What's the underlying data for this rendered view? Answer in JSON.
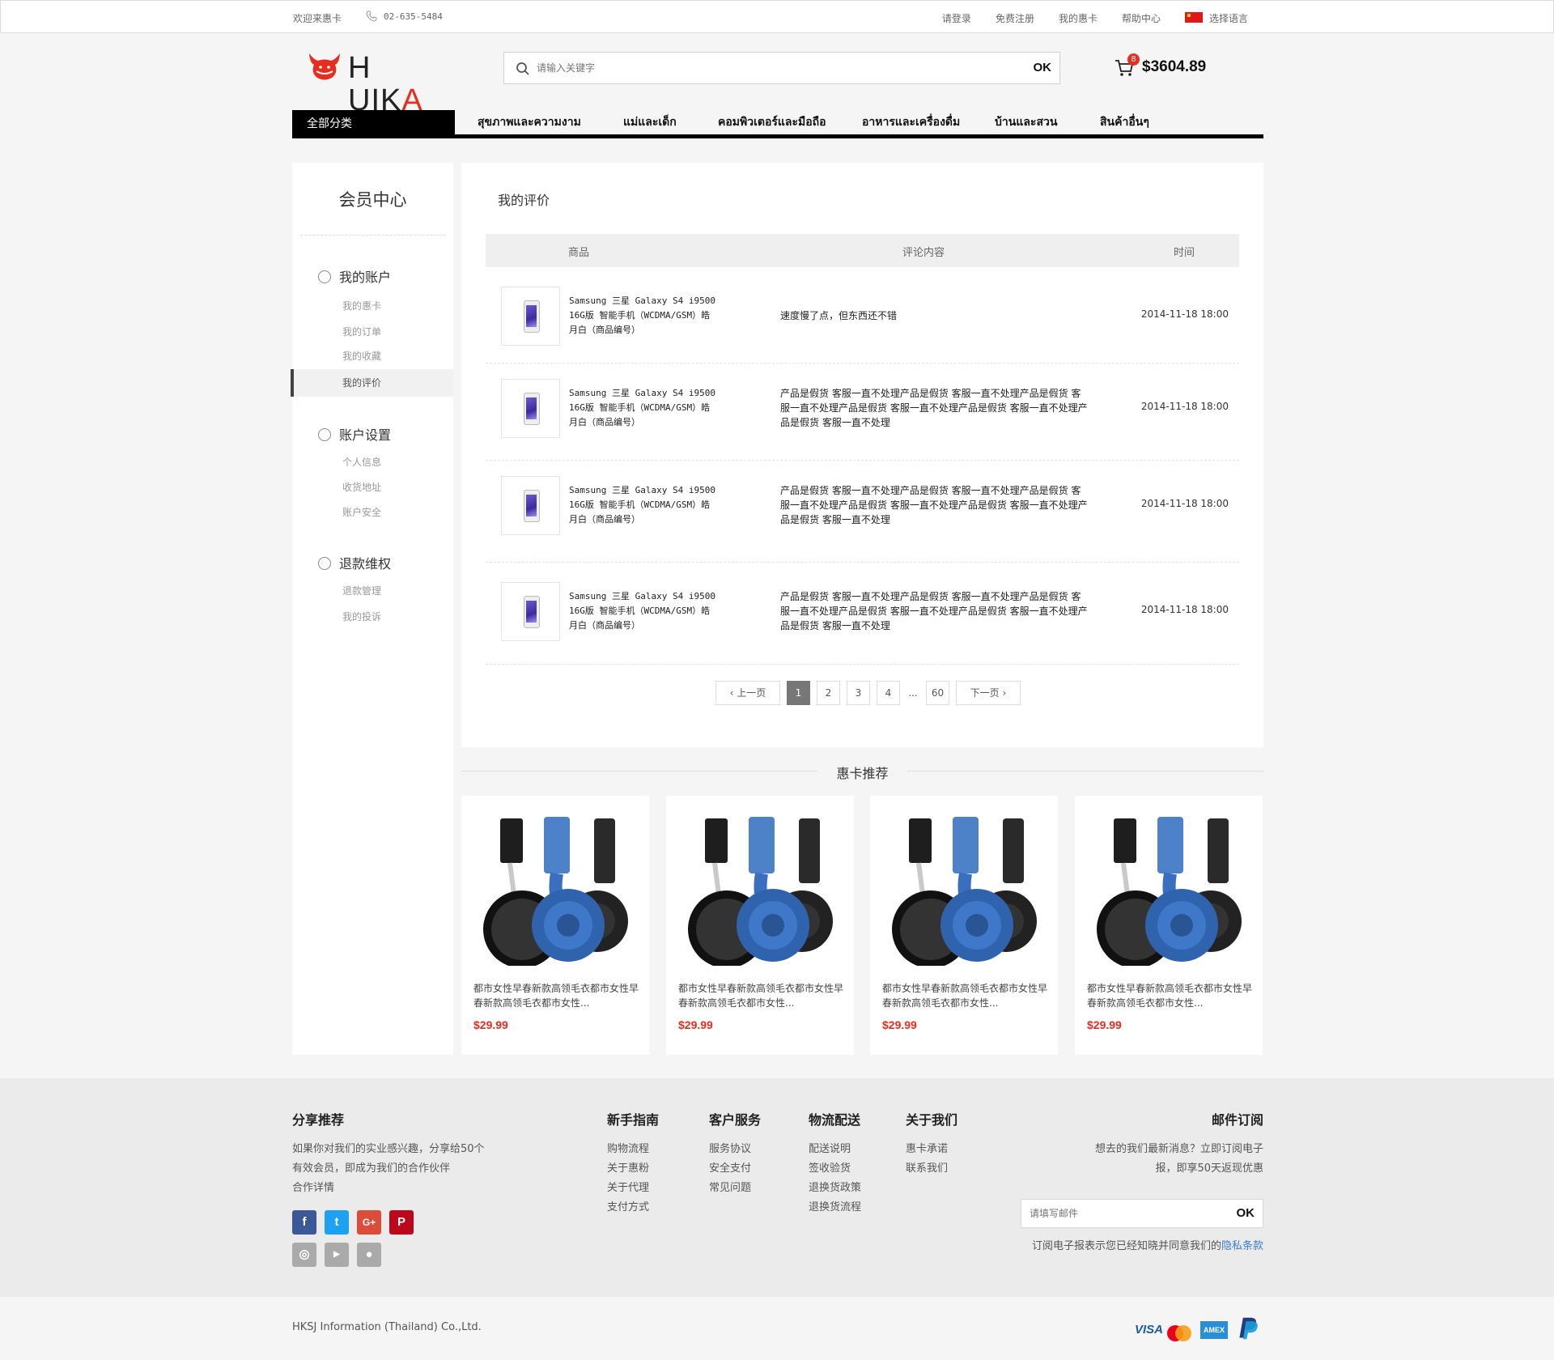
{
  "topbar": {
    "welcome": "欢迎来惠卡",
    "phone": "02-635-5484",
    "links": [
      "请登录",
      "免费注册",
      "我的惠卡",
      "帮助中心"
    ],
    "language": "选择语言"
  },
  "header": {
    "logo": "HUIKA",
    "search_placeholder": "请输入关键字",
    "search_button": "OK",
    "cart_count": "8",
    "cart_total": "$3604.89"
  },
  "nav": {
    "all_categories": "全部分类",
    "items": [
      "สุขภาพและความงาม",
      "แม่และเด็ก",
      "คอมพิวเตอร์และมือถือ",
      "อาหารและเครื่องดื่ม",
      "บ้านและสวน",
      "สินค้าอื่นๆ"
    ]
  },
  "sidebar": {
    "title": "会员中心",
    "groups": [
      {
        "label": "我的账户",
        "items": [
          "我的惠卡",
          "我的订单",
          "我的收藏",
          "我的评价"
        ]
      },
      {
        "label": "账户设置",
        "items": [
          "个人信息",
          "收货地址",
          "账户安全"
        ]
      },
      {
        "label": "退款维权",
        "items": [
          "退款管理",
          "我的投诉"
        ]
      }
    ]
  },
  "main": {
    "title": "我的评价",
    "columns": [
      "商品",
      "评论内容",
      "时间"
    ],
    "rows": [
      {
        "product": "Samsung 三星 Galaxy S4 i9500 16G版 智能手机（WCDMA/GSM）皓月白（商品编号）",
        "comment": "速度慢了点，但东西还不错",
        "time": "2014-11-18 18:00"
      },
      {
        "product": "Samsung 三星 Galaxy S4 i9500 16G版 智能手机（WCDMA/GSM）皓月白（商品编号）",
        "comment": "产品是假货  客服一直不处理产品是假货  客服一直不处理产品是假货  客服一直不处理产品是假货  客服一直不处理产品是假货  客服一直不处理产品是假货  客服一直不处理",
        "time": "2014-11-18 18:00"
      },
      {
        "product": "Samsung 三星 Galaxy S4 i9500 16G版 智能手机（WCDMA/GSM）皓月白（商品编号）",
        "comment": "产品是假货  客服一直不处理产品是假货  客服一直不处理产品是假货  客服一直不处理产品是假货  客服一直不处理产品是假货  客服一直不处理产品是假货  客服一直不处理",
        "time": "2014-11-18 18:00"
      },
      {
        "product": "Samsung 三星 Galaxy S4 i9500 16G版 智能手机（WCDMA/GSM）皓月白（商品编号）",
        "comment": "产品是假货  客服一直不处理产品是假货  客服一直不处理产品是假货  客服一直不处理产品是假货  客服一直不处理产品是假货  客服一直不处理产品是假货  客服一直不处理",
        "time": "2014-11-18 18:00"
      }
    ],
    "pagination": {
      "prev": "上一页",
      "next": "下一页",
      "pages": [
        "1",
        "2",
        "3",
        "4"
      ],
      "ellipsis": "...",
      "last": "60",
      "current": "1"
    }
  },
  "recommend": {
    "title": "惠卡推荐",
    "products": [
      {
        "name": "都市女性早春新款高领毛衣都市女性早春新款高领毛衣都市女性...",
        "price": "$29.99"
      },
      {
        "name": "都市女性早春新款高领毛衣都市女性早春新款高领毛衣都市女性...",
        "price": "$29.99"
      },
      {
        "name": "都市女性早春新款高领毛衣都市女性早春新款高领毛衣都市女性...",
        "price": "$29.99"
      },
      {
        "name": "都市女性早春新款高领毛衣都市女性早春新款高领毛衣都市女性...",
        "price": "$29.99"
      }
    ]
  },
  "footer": {
    "share_title": "分享推荐",
    "share_text": [
      "如果你对我们的实业感兴趣，分享给50个",
      "有效会员，即成为我们的合作伙伴",
      "合作详情"
    ],
    "columns": [
      {
        "title": "新手指南",
        "items": [
          "购物流程",
          "关于惠粉",
          "关于代理",
          "支付方式"
        ]
      },
      {
        "title": "客户服务",
        "items": [
          "服务协议",
          "安全支付",
          "常见问题"
        ]
      },
      {
        "title": "物流配送",
        "items": [
          "配送说明",
          "签收验货",
          "退换货政策",
          "退换货流程"
        ]
      },
      {
        "title": "关于我们",
        "items": [
          "惠卡承诺",
          "联系我们"
        ]
      }
    ],
    "subscribe_title": "邮件订阅",
    "subscribe_text": [
      "想去的我们最新消息？立即订阅电子",
      "报，即享50天返现优惠"
    ],
    "subscribe_placeholder": "请填写邮件",
    "subscribe_button": "OK",
    "subscribe_note": "订阅电子报表示您已经知晓并同意我们的",
    "privacy_link": "隐私条款",
    "company": "HKSJ Information (Thailand) Co.,Ltd.",
    "payments": [
      "VISA",
      "AMEX"
    ]
  },
  "colors": {
    "accent": "#e62d1e",
    "link": "#3b7dd8"
  }
}
